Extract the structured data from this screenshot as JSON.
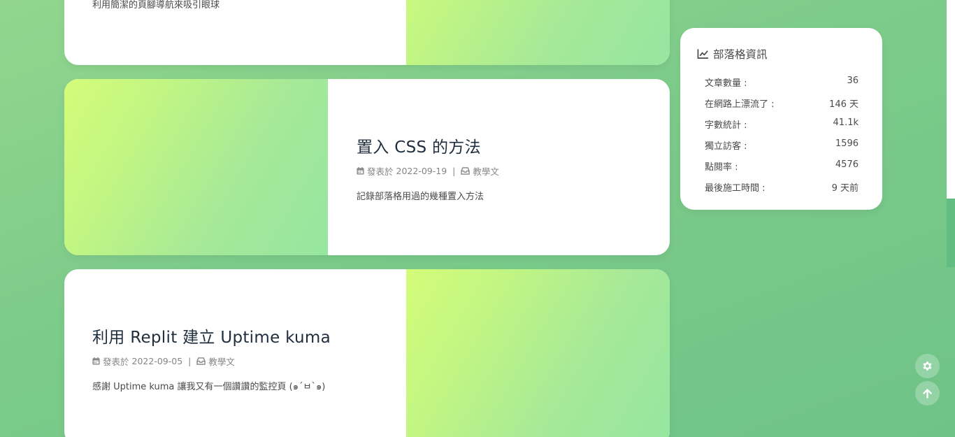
{
  "posts": [
    {
      "title": "",
      "date_prefix": "",
      "date": "",
      "category": "",
      "desc": "利用簡潔的頁腳導航來吸引眼球",
      "cover_side": "right"
    },
    {
      "title": "置入 CSS 的方法",
      "date_prefix": "發表於",
      "date": "2022-09-19",
      "separator": "|",
      "category": "教學文",
      "desc": "記錄部落格用過的幾種置入方法",
      "cover_side": "left"
    },
    {
      "title": "利用 Replit 建立 Uptime kuma",
      "date_prefix": "發表於",
      "date": "2022-09-05",
      "separator": "|",
      "category": "教學文",
      "desc": "感謝 Uptime kuma 讓我又有一個讚讚的監控頁 (๑´ㅂ`๑)",
      "cover_side": "right"
    }
  ],
  "site_info": {
    "title": "部落格資訊",
    "icon": "chart-line-icon",
    "stats": [
      {
        "label": "文章數量 :",
        "value": "36"
      },
      {
        "label": "在網路上漂流了 :",
        "value": "146 天"
      },
      {
        "label": "字數統計 :",
        "value": "41.1k"
      },
      {
        "label": "獨立訪客 :",
        "value": "1596"
      },
      {
        "label": "點閱率 :",
        "value": "4576"
      },
      {
        "label": "最後施工時間 :",
        "value": "9 天前"
      }
    ]
  },
  "rightside": {
    "settings_icon": "gear-icon",
    "to_top_icon": "arrow-up-icon"
  },
  "colors": {
    "cover_gradient_start": "#d4fc79",
    "cover_gradient_end": "#96e6a1",
    "page_background": "#7ccb8a",
    "title_color": "#1f2d3d"
  }
}
